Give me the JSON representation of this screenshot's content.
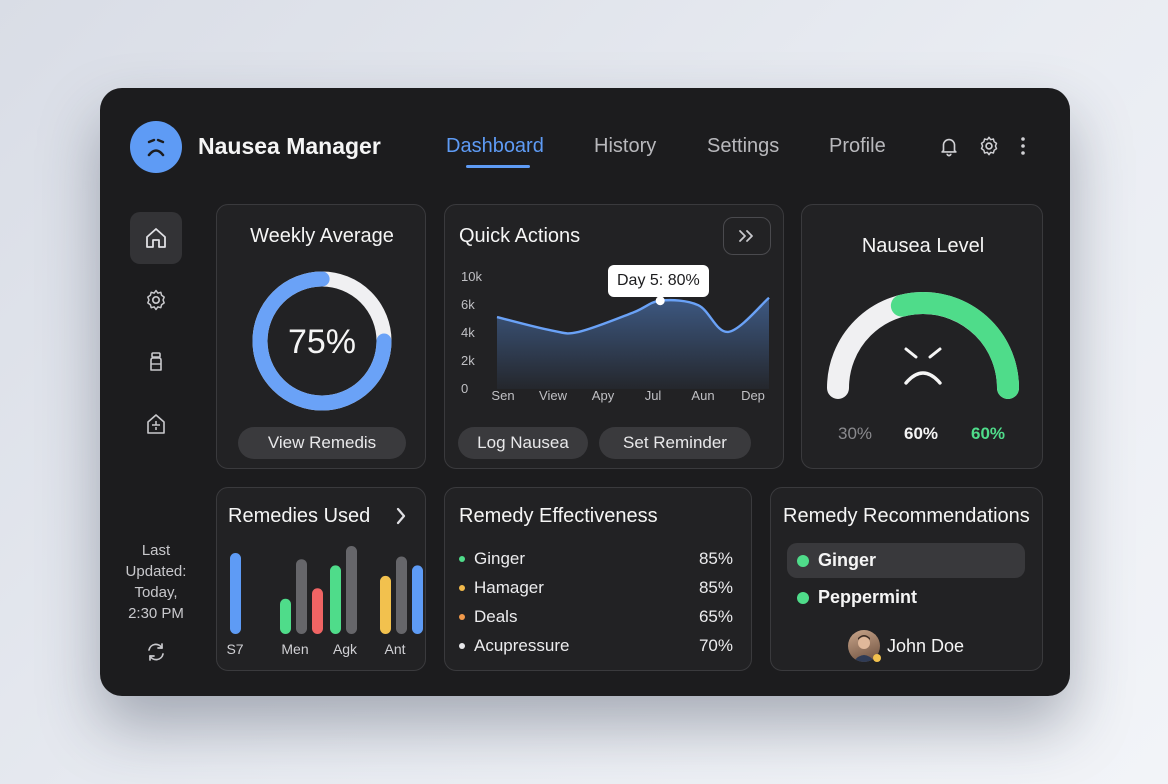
{
  "header": {
    "app_title": "Nausea Manager",
    "nav": [
      "Dashboard",
      "History",
      "Settings",
      "Profile"
    ],
    "active_nav": "Dashboard",
    "icons": [
      "bell-icon",
      "gear-icon",
      "more-vertical-icon"
    ]
  },
  "sidebar": {
    "icons": [
      "home-icon",
      "settings-icon",
      "bottle-icon",
      "cabinet-icon"
    ],
    "last_updated": [
      "Last",
      "Updated:",
      "Today,",
      "2:30 PM"
    ],
    "refresh_icon": "refresh-icon"
  },
  "weekly_average": {
    "title": "Weekly Average",
    "value_label": "75%",
    "value": 75,
    "button": "View Remedis"
  },
  "quick_actions": {
    "title": "Quick Actions",
    "expand_icon": "double-chevron-right-icon",
    "tooltip": "Day 5: 80%",
    "buttons": [
      "Log Nausea",
      "Set Reminder"
    ]
  },
  "nausea_level": {
    "title": "Nausea Level",
    "face_icon": "sad-face-icon",
    "labels": [
      "30%",
      "60%",
      "60%"
    ],
    "level": 60
  },
  "remedies_used": {
    "title": "Remedies Used"
  },
  "remedy_effectiveness": {
    "title": "Remedy Effectiveness",
    "items": [
      {
        "name": "Ginger",
        "value": "85%",
        "color": "#4fdc8a"
      },
      {
        "name": "Hamager",
        "value": "85%",
        "color": "#f2b94b"
      },
      {
        "name": "Deals",
        "value": "65%",
        "color": "#f2994a"
      },
      {
        "name": "Acupressure",
        "value": "70%",
        "color": "#e8e8ea"
      }
    ]
  },
  "recommendations": {
    "title": "Remedy Recommendations",
    "items": [
      "Ginger",
      "Peppermint"
    ],
    "user_name": "John Doe"
  },
  "colors": {
    "accent": "#5e9bf5",
    "green": "#4fdc8a",
    "red": "#f06464",
    "yellow": "#f2c14e",
    "gray_bar": "#66666a"
  },
  "chart_data": [
    {
      "type": "area",
      "x": [
        "Sen",
        "View",
        "Apy",
        "Jul",
        "Aun",
        "Dep"
      ],
      "y_ticks": [
        "10k",
        "6k",
        "4k",
        "2k",
        "0"
      ],
      "points": [
        {
          "t": 0.0,
          "y": 3.9
        },
        {
          "t": 0.2,
          "y": 3.0
        },
        {
          "t": 0.3,
          "y": 2.9
        },
        {
          "t": 0.5,
          "y": 4.2
        },
        {
          "t": 0.6,
          "y": 5.0
        },
        {
          "t": 0.74,
          "y": 4.7
        },
        {
          "t": 0.85,
          "y": 2.9
        },
        {
          "t": 1.0,
          "y": 5.2
        }
      ],
      "highlight": {
        "t": 0.6,
        "label": "Day 5: 80%"
      },
      "line_color": "#5e9bf5"
    },
    {
      "type": "bar",
      "categories": [
        "S7",
        "Men",
        "Agk",
        "Ant"
      ],
      "series": [
        {
          "values": [
            0.92,
            0.4,
            0.78,
            0.66
          ],
          "colors": [
            "#5e9bf5",
            "#4fdc8a",
            "#4fdc8a",
            "#f2c14e"
          ]
        },
        {
          "values": [
            0.0,
            0.85,
            1.0,
            0.88
          ],
          "colors": [
            "#66666a",
            "#66666a",
            "#66666a",
            "#66666a"
          ]
        },
        {
          "values": [
            0.0,
            0.52,
            0.0,
            0.78
          ],
          "colors": [
            "#66666a",
            "#f06464",
            "#66666a",
            "#5e9bf5"
          ]
        }
      ],
      "ylim": [
        0,
        1
      ]
    }
  ]
}
